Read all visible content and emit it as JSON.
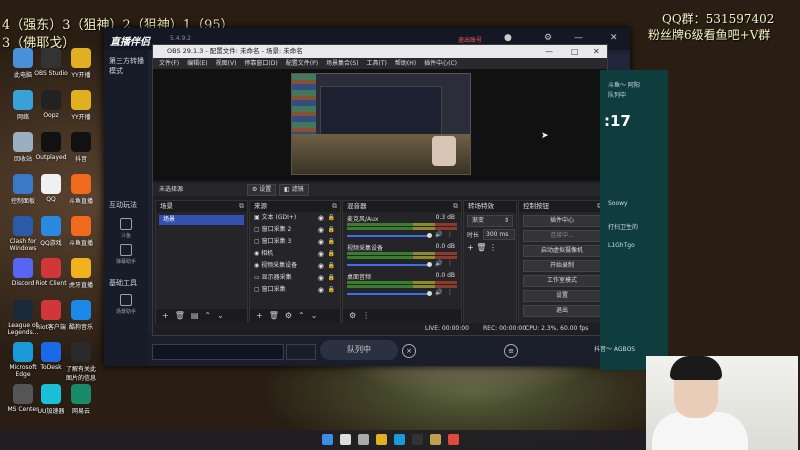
{
  "overlay": {
    "line1": "4（强东）3（狙神）2（狙神）1（95）",
    "line2": "3（佛耶戈）",
    "qq": "QQ群：531597402",
    "fans": "粉丝牌6级看鱼吧+V群"
  },
  "desktop_icons": [
    {
      "label": "此电脑",
      "color": "#4a90d9"
    },
    {
      "label": "OBS Studio",
      "color": "#333333"
    },
    {
      "label": "YY开播",
      "color": "#e0b020"
    },
    {
      "label": "网络",
      "color": "#3aa0d8"
    },
    {
      "label": "Oopz",
      "color": "#222222"
    },
    {
      "label": "YY开播",
      "color": "#e0b020"
    },
    {
      "label": "回收站",
      "color": "#9ab0c0"
    },
    {
      "label": "Outplayed",
      "color": "#111111"
    },
    {
      "label": "抖音",
      "color": "#111111"
    },
    {
      "label": "控制面板",
      "color": "#3a78c8"
    },
    {
      "label": "QQ",
      "color": "#f0f0f0"
    },
    {
      "label": "斗鱼直播",
      "color": "#f06a1e"
    },
    {
      "label": "Clash for Windows",
      "color": "#2a5aa8"
    },
    {
      "label": "QQ游戏",
      "color": "#2a8ae0"
    },
    {
      "label": "斗鱼直播",
      "color": "#f06a1e"
    },
    {
      "label": "Discord",
      "color": "#5865f2"
    },
    {
      "label": "Riot Client",
      "color": "#d13639"
    },
    {
      "label": "虎牙直播",
      "color": "#f0b21e"
    },
    {
      "label": "League of Legends...",
      "color": "#1a2a3a"
    },
    {
      "label": "Riot客户端",
      "color": "#d13639"
    },
    {
      "label": "酷狗音乐",
      "color": "#1a8ae8"
    },
    {
      "label": "Microsoft Edge",
      "color": "#1a9ad8"
    },
    {
      "label": "ToDesk",
      "color": "#1a6ae8"
    },
    {
      "label": "了解有关此图片的信息",
      "color": "#2a2a2a"
    },
    {
      "label": "MS Center",
      "color": "#555555"
    },
    {
      "label": "UU加速器",
      "color": "#1ac0d8"
    },
    {
      "label": "网易云",
      "color": "#1a8a6a"
    }
  ],
  "host": {
    "logo": "直播伴侣",
    "version": "5.4.9.2",
    "exit_label": "退出账号",
    "side_header": "第三方转播模式",
    "section_interact": "互动玩法",
    "section_tools": "基础工具",
    "side_items": [
      "斗鱼",
      "弹幕助手",
      "场景助手"
    ],
    "queue_label": "队列中"
  },
  "obs": {
    "title": "OBS 29.1.3 - 配置文件: 未命名 - 场景: 未命名",
    "menu": [
      "文件(F)",
      "编辑(E)",
      "视图(V)",
      "停靠窗口(D)",
      "配置文件(P)",
      "场景集合(S)",
      "工具(T)",
      "帮助(H)",
      "插件中心(C)"
    ],
    "source_bar": {
      "label": "未选择源",
      "settings": "设置",
      "filters": "滤镜"
    },
    "docks": {
      "scenes": {
        "title": "场景",
        "items": [
          "场景"
        ]
      },
      "sources": {
        "title": "来源",
        "items": [
          "文本 (GDI+)",
          "窗口采集 2",
          "窗口采集 3",
          "相机",
          "视频采集设备",
          "显示器采集",
          "窗口采集"
        ]
      },
      "mixer": {
        "title": "混音器",
        "channels": [
          {
            "name": "麦克风/Aux",
            "db": "0.3 dB"
          },
          {
            "name": "视频采集设备",
            "db": "0.0 dB"
          },
          {
            "name": "桌面音频",
            "db": "0.0 dB"
          }
        ]
      },
      "transitions": {
        "title": "转场特效",
        "type": "渐变",
        "duration_label": "时长",
        "duration": "300 ms"
      },
      "controls": {
        "title": "控制按钮",
        "buttons": [
          "插件中心",
          "连接中...",
          "启动虚拟摄像机",
          "开始录制",
          "工作室模式",
          "设置",
          "退出"
        ]
      }
    },
    "status": {
      "live": "LIVE: 00:00:00",
      "rec": "REC: 00:00:00",
      "cpu": "CPU: 2.3%, 60.00 fps"
    }
  },
  "right_panel": {
    "clock": ":17",
    "texts": [
      "斗鱼～ 阿阳",
      "队列中",
      "Soowy",
      "打扫卫生的",
      "L1GhTgo",
      "抖音～ AGBOS"
    ]
  },
  "taskbar": {
    "icons": [
      "windows-icon",
      "search-icon",
      "taskview-icon",
      "explorer-icon",
      "edge-icon",
      "obs-icon",
      "app-icon",
      "chrome-icon",
      "music-icon"
    ]
  }
}
